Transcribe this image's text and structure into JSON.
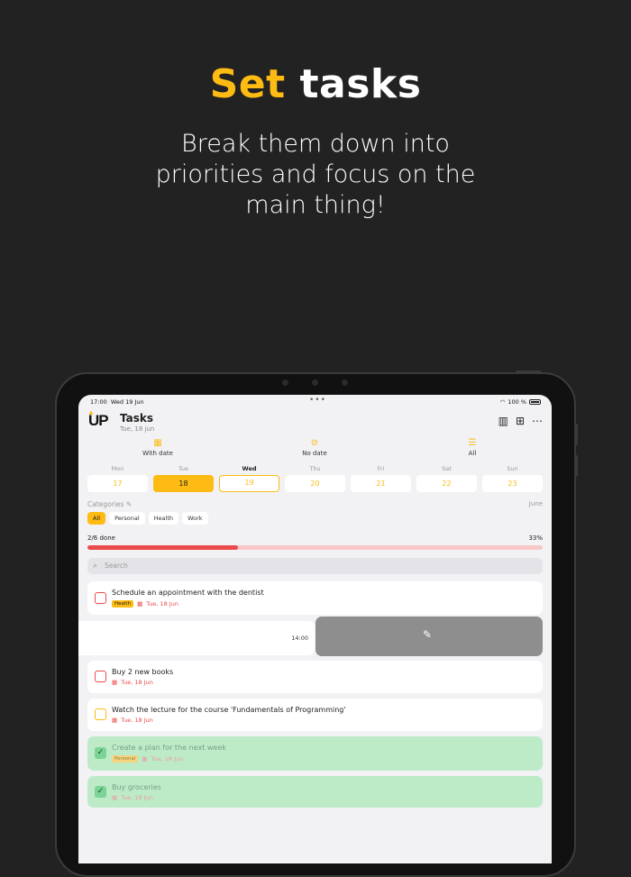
{
  "hero": {
    "title_accent": "Set",
    "title_rest": "tasks",
    "subtitle": "Break them down into priorities and focus on the main thing!"
  },
  "status": {
    "time": "17:00",
    "date": "Wed 19 Jun",
    "battery": "100 %",
    "dots": "•••"
  },
  "header": {
    "logo": "UP",
    "title": "Tasks",
    "subtitle": "Tue, 18 jun",
    "icons": [
      "columns-icon",
      "grid-icon",
      "more-icon"
    ]
  },
  "modes": [
    {
      "label": "With date",
      "icon": "calendar-icon"
    },
    {
      "label": "No date",
      "icon": "calendar-off-icon"
    },
    {
      "label": "All",
      "icon": "list-icon"
    }
  ],
  "days": [
    {
      "name": "Mon",
      "num": "17"
    },
    {
      "name": "Tue",
      "num": "18"
    },
    {
      "name": "Wed",
      "num": "19"
    },
    {
      "name": "Thu",
      "num": "20"
    },
    {
      "name": "Fri",
      "num": "21"
    },
    {
      "name": "Sat",
      "num": "22"
    },
    {
      "name": "Sun",
      "num": "23"
    }
  ],
  "categories": {
    "label": "Categories",
    "month": "June",
    "chips": [
      "All",
      "Personal",
      "Health",
      "Work"
    ]
  },
  "progress": {
    "label": "2/6 done",
    "percent": "33%",
    "value": 0.33
  },
  "search": {
    "placeholder": "Search"
  },
  "swipe": {
    "time": "14:00"
  },
  "tasks": [
    {
      "title": "Schedule an appointment with the dentist",
      "tag": "Health",
      "date": "Tue, 18 Jun"
    },
    {
      "title": "Buy 2 new books",
      "date": "Tue, 18 Jun"
    },
    {
      "title": "Watch the lecture for the course 'Fundamentals of Programming'",
      "date": "Tue, 18 Jun"
    },
    {
      "title": "Create a plan for the next week",
      "tag": "Personal",
      "date": "Tue, 18 Jun"
    },
    {
      "title": "Buy groceries",
      "date": "Tue, 18 Jun"
    }
  ],
  "colors": {
    "accent": "#FDBB13",
    "danger": "#EC4B4B",
    "done": "#BDEBC8"
  }
}
